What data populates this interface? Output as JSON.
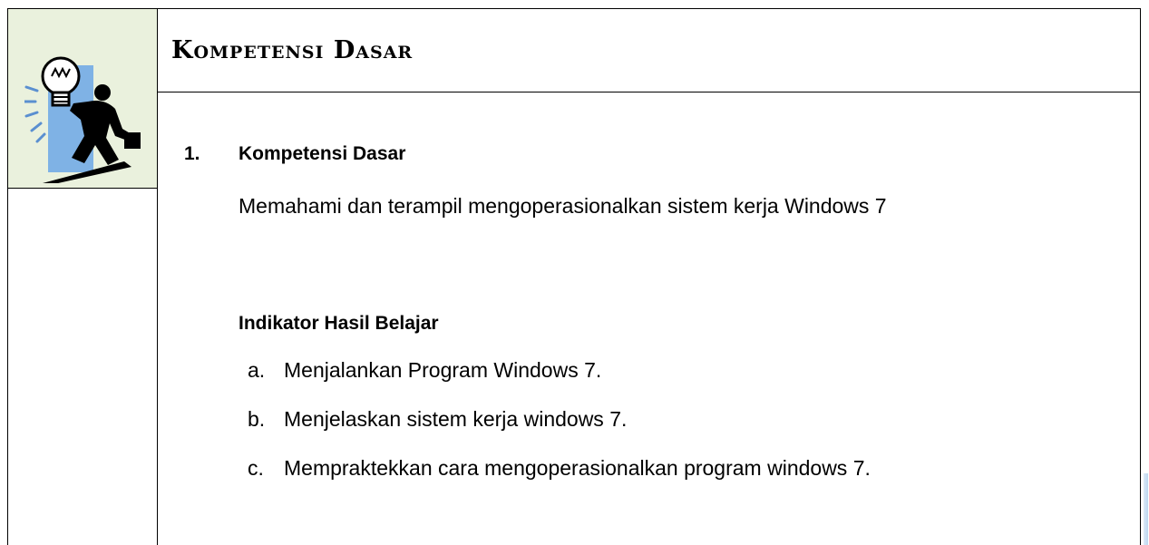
{
  "icon": {
    "name": "lightbulb-person-icon"
  },
  "header": {
    "title": "Kompetensi Dasar"
  },
  "content": {
    "item_number": "1.",
    "item_heading": "Kompetensi Dasar",
    "item_description": "Memahami dan terampil mengoperasionalkan sistem  kerja Windows 7",
    "indicator_heading": "Indikator Hasil Belajar",
    "indicators": [
      {
        "marker": "a.",
        "text": "Menjalankan Program Windows 7."
      },
      {
        "marker": "b.",
        "text": "Menjelaskan sistem kerja windows 7."
      },
      {
        "marker": "c.",
        "text": "Mempraktekkan cara mengoperasionalkan program windows 7."
      }
    ]
  },
  "colors": {
    "icon_background": "#eaf1dd",
    "icon_accent_blue": "#7fb2e5",
    "border": "#000000"
  }
}
